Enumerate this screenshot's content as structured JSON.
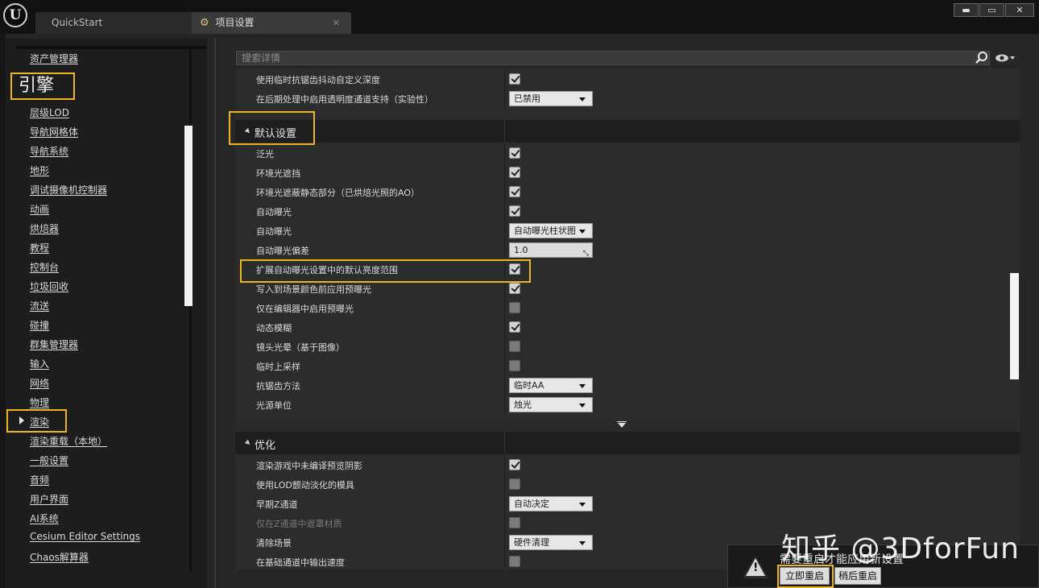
{
  "app": {
    "logo": "U"
  },
  "tabs": [
    {
      "label": "QuickStart"
    },
    {
      "label": "项目设置",
      "icon": "gear-icon"
    }
  ],
  "window_controls": {
    "minimize": "▬",
    "maximize": "▭",
    "close": "✕"
  },
  "sidebar": {
    "top_item": "资产管理器",
    "category": "引擎",
    "items": [
      "层级LOD",
      "导航网格体",
      "导航系统",
      "地形",
      "调试摄像机控制器",
      "动画",
      "烘焙器",
      "教程",
      "控制台",
      "垃圾回收",
      "流送",
      "碰撞",
      "群集管理器",
      "输入",
      "网络",
      "物理",
      "渲染",
      "渲染重载（本地）",
      "一般设置",
      "音频",
      "用户界面",
      "AI系统",
      "Cesium Editor Settings",
      "Chaos解算器"
    ],
    "active_item": "渲染"
  },
  "search": {
    "placeholder": "搜索详情"
  },
  "details": {
    "pre_rows": [
      {
        "label": "使用临时抗锯齿抖动自定义深度",
        "type": "check",
        "checked": true
      },
      {
        "label": "在后期处理中启用透明度通道支持（实验性）",
        "type": "combo",
        "value": "已禁用"
      }
    ],
    "section1": {
      "title": "默认设置",
      "rows": [
        {
          "label": "泛光",
          "type": "check",
          "checked": true
        },
        {
          "label": "环境光遮挡",
          "type": "check",
          "checked": true
        },
        {
          "label": "环境光遮蔽静态部分（已烘焙光照的AO）",
          "type": "check",
          "checked": true
        },
        {
          "label": "自动曝光",
          "type": "check",
          "checked": true
        },
        {
          "label": "自动曝光",
          "type": "combo",
          "value": "自动曝光柱状图"
        },
        {
          "label": "自动曝光偏差",
          "type": "number",
          "value": "1.0"
        },
        {
          "label": "扩展自动曝光设置中的默认亮度范围",
          "type": "check",
          "checked": true
        },
        {
          "label": "写入到场景颜色前应用预曝光",
          "type": "check",
          "checked": true
        },
        {
          "label": "仅在编辑器中启用预曝光",
          "type": "check",
          "checked": false
        },
        {
          "label": "动态模糊",
          "type": "check",
          "checked": true
        },
        {
          "label": "镜头光晕（基于图像）",
          "type": "check",
          "checked": false
        },
        {
          "label": "临时上采样",
          "type": "check",
          "checked": false
        },
        {
          "label": "抗锯齿方法",
          "type": "combo",
          "value": "临时AA"
        },
        {
          "label": "光源单位",
          "type": "combo",
          "value": "烛光"
        }
      ]
    },
    "section2": {
      "title": "优化",
      "rows": [
        {
          "label": "渲染游戏中未编译预览阴影",
          "type": "check",
          "checked": true
        },
        {
          "label": "使用LOD颤动淡化的模具",
          "type": "check",
          "checked": false
        },
        {
          "label": "早期Z通道",
          "type": "combo",
          "value": "自动决定"
        },
        {
          "label": "仅在Z通道中遮罩材质",
          "type": "check",
          "checked": false,
          "disabled": true
        },
        {
          "label": "清除场景",
          "type": "combo",
          "value": "硬件清理"
        },
        {
          "label": "在基础通道中输出速度",
          "type": "check",
          "checked": false
        }
      ]
    }
  },
  "notification": {
    "message": "需要重启才能应用新设置",
    "restart_now": "立即重启",
    "restart_later": "稍后重启"
  },
  "watermark": "知乎 @3DforFun",
  "colors": {
    "highlight": "#f0b41e",
    "background": "#262626"
  }
}
